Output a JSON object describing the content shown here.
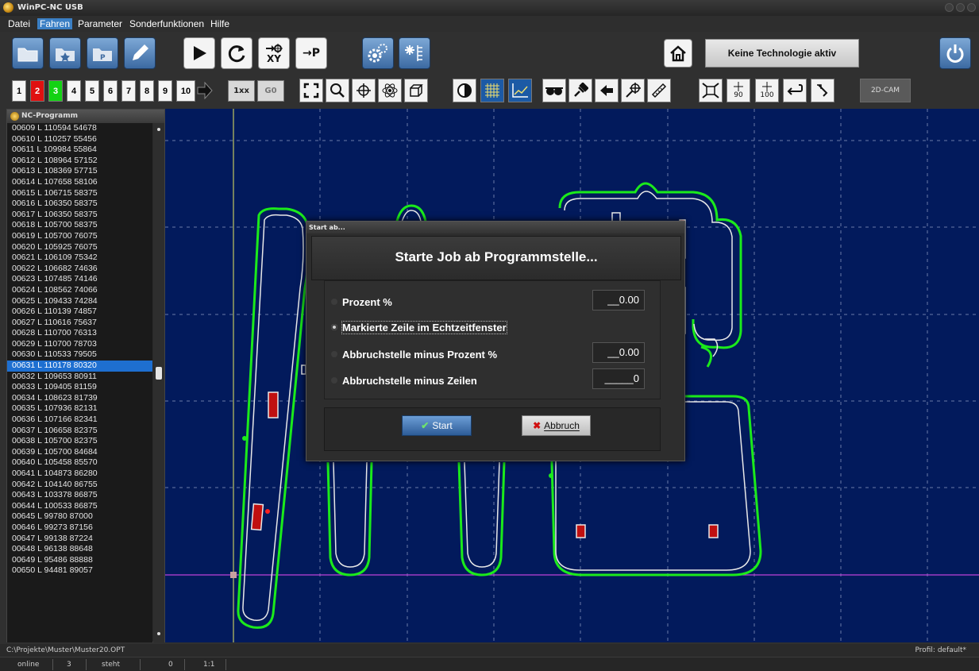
{
  "window": {
    "title": "WinPC-NC USB"
  },
  "menu": [
    "Datei",
    "Fahren",
    "Parameter",
    "Sonderfunktionen",
    "Hilfe"
  ],
  "menu_active": "Fahren",
  "toolbar1": {
    "move_xy_label": "XY",
    "move_p_label": "→P",
    "technology_button": "Keine Technologie aktiv"
  },
  "toolbar2": {
    "axis_buttons": [
      "1",
      "2",
      "3",
      "4",
      "5",
      "6",
      "7",
      "8",
      "9",
      "10"
    ],
    "speed_label": "1xx",
    "g0_label": "G0",
    "cam_label": "2D-CAM",
    "rotate90_label": "90",
    "rotate100_label": "100"
  },
  "nc_panel": {
    "title": "NC-Programm",
    "lines": [
      "00609  L 110594 54678",
      "00610  L 110257 55456",
      "00611  L 109984 55864",
      "00612  L 108964 57152",
      "00613  L 108369 57715",
      "00614  L 107658 58106",
      "00615  L 106715 58375",
      "00616  L 106350 58375",
      "00617  L 106350 58375",
      "00618  L 105700 58375",
      "00619  L 105700 76075",
      "00620  L 105925 76075",
      "00621  L 106109 75342",
      "00622  L 106682 74636",
      "00623  L 107485 74146",
      "00624  L 108562 74066",
      "00625  L 109433 74284",
      "00626  L 110139 74857",
      "00627  L 110616 75637",
      "00628  L 110700 76313",
      "00629  L 110700 78703",
      "00630  L 110533 79505",
      "00631  L 110178 80320",
      "00632  L 109653 80911",
      "00633  L 109405 81159",
      "00634  L 108623 81739",
      "00635  L 107936 82131",
      "00636  L 107166 82341",
      "00637  L 106658 82375",
      "00638  L 105700 82375",
      "00639  L 105700 84684",
      "00640  L 105458 85570",
      "00641  L 104873 86280",
      "00642  L 104140 86755",
      "00643  L 103378 86875",
      "00644  L 100533 86875",
      "00645  L 99780 87000",
      "00646  L 99273 87156",
      "00647  L 99138 87224",
      "00648  L 96138 88648",
      "00649  L 95486 88888",
      "00650  L 94481 89057"
    ],
    "selected_index": 22
  },
  "dialog": {
    "window_title": "Start ab...",
    "heading": "Starte Job ab Programmstelle...",
    "options": [
      {
        "label": "Prozent %",
        "value": "__0.00",
        "selected": false
      },
      {
        "label": "Markierte Zeile im Echtzeitfenster",
        "value": null,
        "selected": true
      },
      {
        "label": "Abbruchstelle minus Prozent %",
        "value": "__0.00",
        "selected": false
      },
      {
        "label": "Abbruchstelle minus Zeilen",
        "value": "_____0",
        "selected": false
      }
    ],
    "start_label": "Start",
    "abbruch_label": "Abbruch"
  },
  "status": {
    "file_path": "C:\\Projekte\\Muster\\Muster20.OPT",
    "profile": "Profil: default*",
    "connection": "online",
    "count": "3",
    "state": "steht",
    "value": "0",
    "scale": "1:1"
  },
  "colors": {
    "canvas_bg": "#021a5c",
    "contour_outer": "#1bea1b",
    "contour_inner": "#e8e8e8",
    "selection": "#1e6fd0",
    "crosshair_vertical": "#e8e860",
    "crosshair_horizontal": "#c040d8"
  },
  "icons": [
    "folder-open-icon",
    "folder-star-icon",
    "folder-p-icon",
    "pencil-icon",
    "play-icon",
    "refresh-icon",
    "move-xy-icon",
    "move-p-icon",
    "settings-gears-icon",
    "toolpath-icon",
    "home-icon",
    "power-icon",
    "zoom-fit-icon",
    "zoom-icon",
    "pan-icon",
    "atom-icon",
    "3d-box-icon",
    "contrast-icon",
    "grid-icon",
    "chart-icon",
    "glasses-icon",
    "pin-icon",
    "arrow-left-icon",
    "move-origin-icon",
    "ruler-icon",
    "scale-icon",
    "rotate90-icon",
    "rotate100-icon",
    "loop-icon",
    "path-icon"
  ]
}
